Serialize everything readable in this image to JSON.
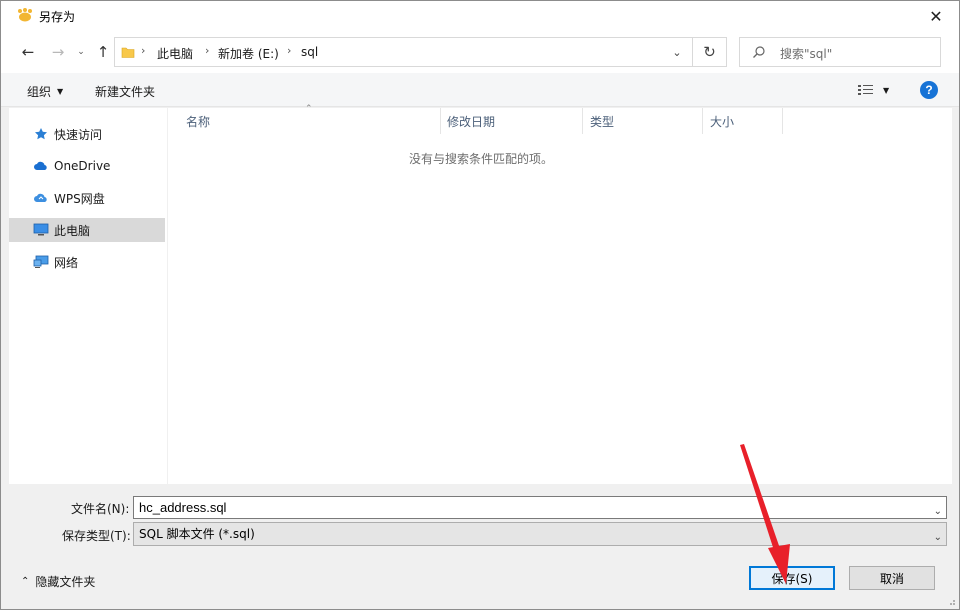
{
  "window": {
    "title": "另存为",
    "close_glyph": "✕"
  },
  "nav": {
    "back_glyph": "←",
    "forward_glyph": "→",
    "recent_glyph": "⌄",
    "up_glyph": "↑",
    "breadcrumb": [
      "此电脑",
      "新加卷 (E:)",
      "sql"
    ],
    "separator": "›",
    "dropdown_glyph": "⌄",
    "refresh_glyph": "↻"
  },
  "search": {
    "placeholder": "搜索\"sql\""
  },
  "toolbar": {
    "organize_label": "组织",
    "organize_caret": "▼",
    "new_folder_label": "新建文件夹",
    "view_caret": "▼",
    "help_label": "?"
  },
  "sidebar": {
    "items": [
      {
        "label": "快速访问",
        "icon": "star-icon"
      },
      {
        "label": "OneDrive",
        "icon": "cloud-icon"
      },
      {
        "label": "WPS网盘",
        "icon": "wps-cloud-icon"
      },
      {
        "label": "此电脑",
        "icon": "computer-icon",
        "selected": true
      },
      {
        "label": "网络",
        "icon": "network-icon"
      }
    ]
  },
  "file_list": {
    "sort_glyph": "⌃",
    "columns": [
      "名称",
      "修改日期",
      "类型",
      "大小"
    ],
    "empty_message": "没有与搜索条件匹配的项。"
  },
  "form": {
    "filename_label": "文件名(N):",
    "filename_value": "hc_address.sql",
    "filetype_label": "保存类型(T):",
    "filetype_value": "SQL 脚本文件 (*.sql)",
    "combo_glyph": "⌄"
  },
  "footer": {
    "hide_folders_glyph": "⌃",
    "hide_folders_label": "隐藏文件夹",
    "save_label": "保存(S)",
    "cancel_label": "取消"
  },
  "colors": {
    "accent": "#0078d7",
    "annotation_arrow": "#e8202a",
    "folder_yellow": "#f8c84a"
  }
}
